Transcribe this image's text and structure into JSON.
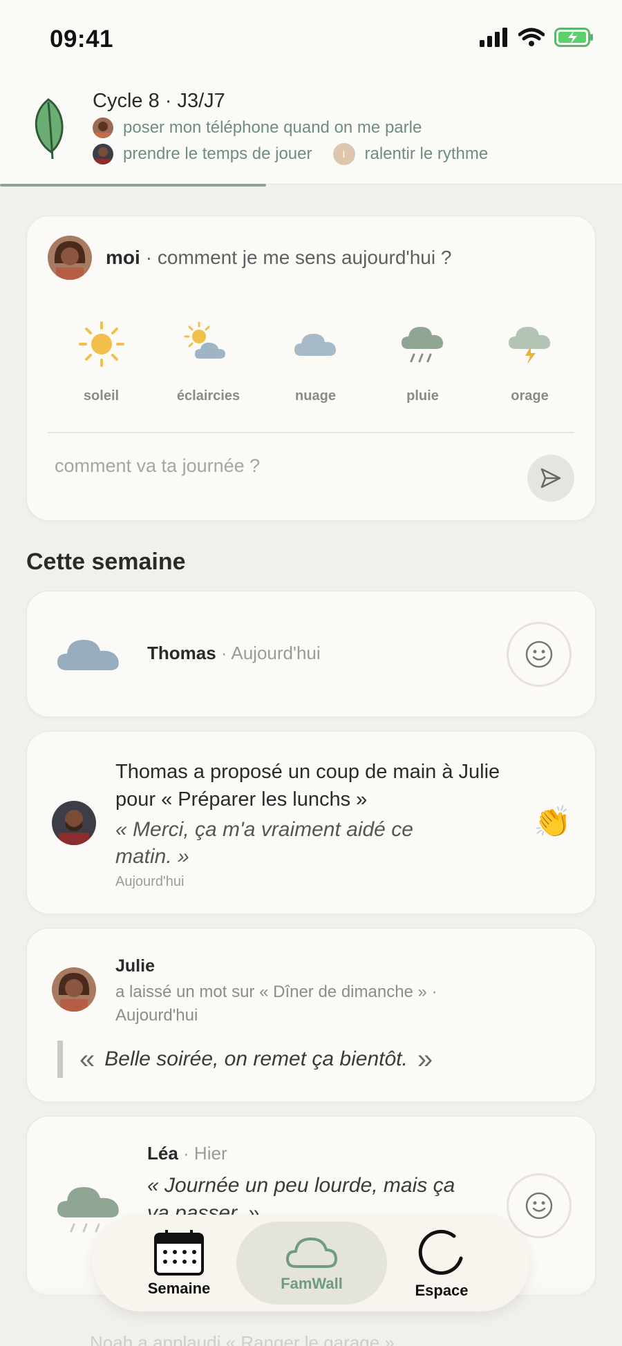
{
  "status_bar": {
    "time": "09:41"
  },
  "header": {
    "cycle_title": "Cycle 8 · J3/J7",
    "goals": [
      {
        "text": "poser mon téléphone quand on me parle"
      },
      {
        "text": "prendre le temps de jouer"
      },
      {
        "text": "ralentir le rythme",
        "avatar_initial": "I"
      }
    ]
  },
  "mood_card": {
    "user": "moi",
    "question": "· comment je me sens aujourd'hui ?",
    "options": [
      {
        "label": "soleil",
        "icon": "sun-icon"
      },
      {
        "label": "éclaircies",
        "icon": "sun-cloud-icon"
      },
      {
        "label": "nuage",
        "icon": "cloud-icon"
      },
      {
        "label": "pluie",
        "icon": "rain-icon"
      },
      {
        "label": "orage",
        "icon": "storm-icon"
      }
    ],
    "input_placeholder": "comment va ta journée ?"
  },
  "section_title": "Cette semaine",
  "feed": [
    {
      "name": "Thomas",
      "when": "· Aujourd'hui",
      "weather": "cloud-icon"
    },
    {
      "text": "Thomas a proposé un coup de main à Julie pour « Préparer les lunchs »",
      "quote": "« Merci, ça m'a vraiment aidé ce matin. »",
      "when": "Aujourd'hui",
      "reaction": "👏"
    },
    {
      "name": "Julie",
      "meta": "a laissé un mot sur « Dîner de dimanche » · Aujourd'hui",
      "quote_open": "«",
      "quote": "Belle soirée, on remet ça bientôt.",
      "quote_close": "»"
    },
    {
      "name": "Léa",
      "when": "· Hier",
      "quote": "« Journée un peu lourde, mais ça va passer. »",
      "weather": "rain-icon"
    }
  ],
  "peek_text": "Noah a applaudi « Ranger le garage »",
  "tabbar": {
    "tabs": [
      {
        "label": "Semaine",
        "icon": "calendar-icon"
      },
      {
        "label": "FamWall",
        "icon": "cloud-icon",
        "active": true
      },
      {
        "label": "Espace",
        "icon": "circle-icon"
      }
    ]
  },
  "colors": {
    "background": "#f2f0ea",
    "card": "#fbfaf7",
    "accent_green": "#6e8f79",
    "sun": "#f0c04a"
  }
}
